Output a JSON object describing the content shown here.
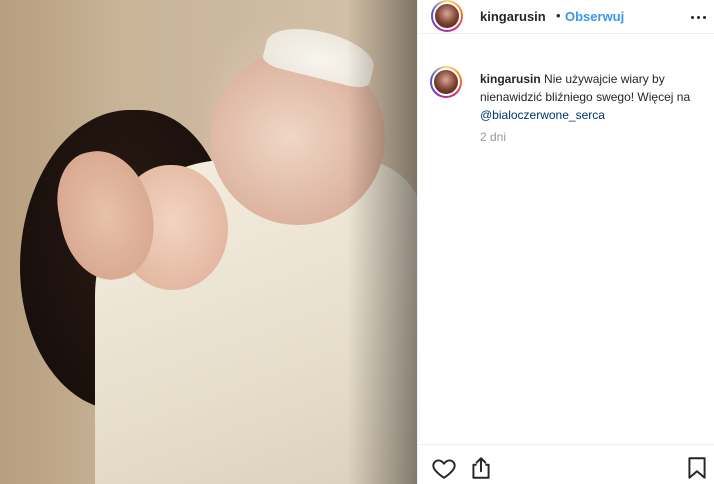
{
  "header": {
    "username": "kingarusin",
    "separator": "•",
    "follow_label": "Obserwuj",
    "more_icon": "more-options-icon"
  },
  "caption": {
    "username": "kingarusin",
    "text": "Nie używajcie wiary by nienawidzić bliźniego swego! Więcej na ",
    "mention": "@bialoczerwone_serca",
    "time": "2 dni"
  },
  "actions": {
    "like_icon": "heart-icon",
    "share_icon": "share-icon",
    "save_icon": "bookmark-icon"
  },
  "colors": {
    "follow": "#3897f0",
    "mention": "#003569",
    "timestamp": "#999999",
    "border": "#efefef"
  }
}
